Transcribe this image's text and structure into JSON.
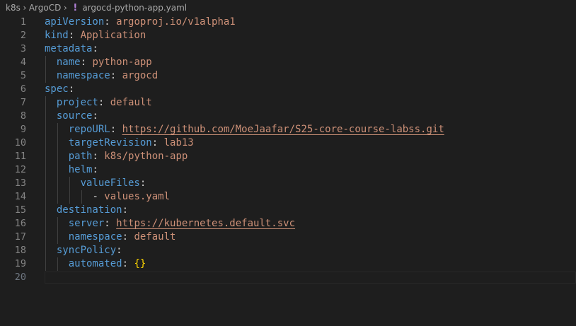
{
  "breadcrumb": {
    "items": [
      "k8s",
      "ArgoCD"
    ],
    "file_icon": "!",
    "file_name": "argocd-python-app.yaml"
  },
  "editor": {
    "lines": [
      {
        "num": "1",
        "indent": "",
        "key": "apiVersion",
        "sep": ": ",
        "value": "argoproj.io/v1alpha1"
      },
      {
        "num": "2",
        "indent": "",
        "key": "kind",
        "sep": ": ",
        "value": "Application"
      },
      {
        "num": "3",
        "indent": "",
        "key": "metadata",
        "sep": ":",
        "value": ""
      },
      {
        "num": "4",
        "indent": "  ",
        "key": "name",
        "sep": ": ",
        "value": "python-app"
      },
      {
        "num": "5",
        "indent": "  ",
        "key": "namespace",
        "sep": ": ",
        "value": "argocd"
      },
      {
        "num": "6",
        "indent": "",
        "key": "spec",
        "sep": ":",
        "value": ""
      },
      {
        "num": "7",
        "indent": "  ",
        "key": "project",
        "sep": ": ",
        "value": "default"
      },
      {
        "num": "8",
        "indent": "  ",
        "key": "source",
        "sep": ":",
        "value": ""
      },
      {
        "num": "9",
        "indent": "    ",
        "key": "repoURL",
        "sep": ": ",
        "value": "https://github.com/MoeJaafar/S25-core-course-labss.git",
        "link": true
      },
      {
        "num": "10",
        "indent": "    ",
        "key": "targetRevision",
        "sep": ": ",
        "value": "lab13"
      },
      {
        "num": "11",
        "indent": "    ",
        "key": "path",
        "sep": ": ",
        "value": "k8s/python-app"
      },
      {
        "num": "12",
        "indent": "    ",
        "key": "helm",
        "sep": ":",
        "value": ""
      },
      {
        "num": "13",
        "indent": "      ",
        "key": "valueFiles",
        "sep": ":",
        "value": ""
      },
      {
        "num": "14",
        "indent": "        ",
        "key": "",
        "sep": "- ",
        "value": "values.yaml"
      },
      {
        "num": "15",
        "indent": "  ",
        "key": "destination",
        "sep": ":",
        "value": ""
      },
      {
        "num": "16",
        "indent": "    ",
        "key": "server",
        "sep": ": ",
        "value": "https://kubernetes.default.svc",
        "link": true
      },
      {
        "num": "17",
        "indent": "    ",
        "key": "namespace",
        "sep": ": ",
        "value": "default"
      },
      {
        "num": "18",
        "indent": "  ",
        "key": "syncPolicy",
        "sep": ":",
        "value": ""
      },
      {
        "num": "19",
        "indent": "    ",
        "key": "automated",
        "sep": ": ",
        "value": "{}",
        "brace": true
      },
      {
        "num": "20",
        "indent": "",
        "key": "",
        "sep": "",
        "value": "",
        "current": true
      }
    ]
  },
  "colors": {
    "background": "#1e1e1e",
    "key": "#569cd6",
    "string": "#ce9178",
    "brace": "#ffd700",
    "line_number": "#858585"
  }
}
